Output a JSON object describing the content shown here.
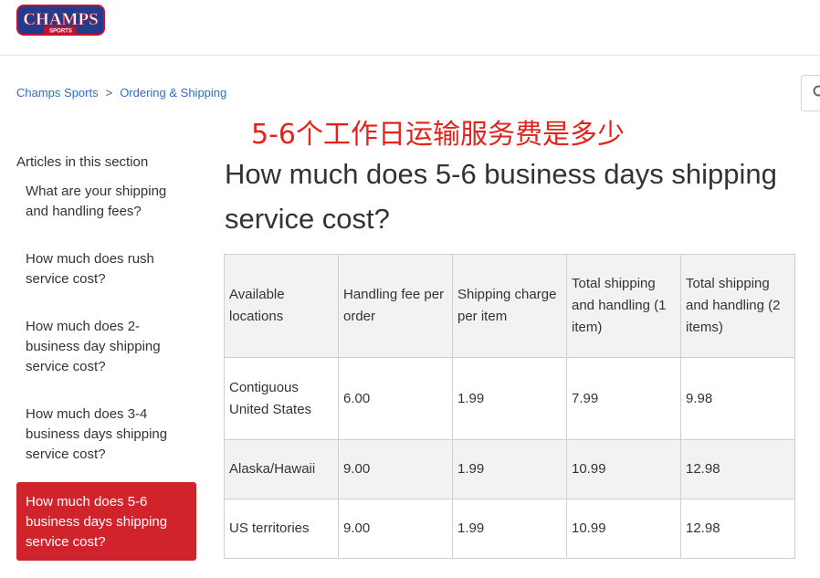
{
  "logo": {
    "text": "CHAMPS",
    "subtext": "SPORTS"
  },
  "breadcrumb": {
    "home": "Champs Sports",
    "separator": ">",
    "section": "Ordering & Shipping"
  },
  "annotation": "5-6个工作日运输服务费是多少",
  "sidebar": {
    "title": "Articles in this section",
    "items": [
      {
        "label": "What are your shipping and handling fees?"
      },
      {
        "label": "How much does rush service cost?"
      },
      {
        "label": "How much does 2-business day shipping service cost?"
      },
      {
        "label": "How much does 3-4 business days shipping service cost?"
      },
      {
        "label": "How much does 5-6 business days shipping service cost?"
      }
    ]
  },
  "article": {
    "title": "How much does 5-6 business days shipping service cost?"
  },
  "table": {
    "headers": [
      "Available locations",
      "Handling fee per order",
      "Shipping charge per item",
      "Total shipping and handling (1 item)",
      "Total shipping and handling (2 items)"
    ],
    "rows": [
      [
        "Contiguous United States",
        "6.00",
        "1.99",
        "7.99",
        "9.98"
      ],
      [
        "Alaska/Hawaii",
        "9.00",
        "1.99",
        "10.99",
        "12.98"
      ],
      [
        "US territories",
        "9.00",
        "1.99",
        "10.99",
        "12.98"
      ]
    ]
  },
  "colors": {
    "accent": "#d0232b",
    "link": "#2e6fc4",
    "annotation": "#e3231c",
    "logo_blue": "#1f3c8f",
    "logo_red": "#c8102e"
  },
  "icons": {
    "search": "search-icon"
  }
}
